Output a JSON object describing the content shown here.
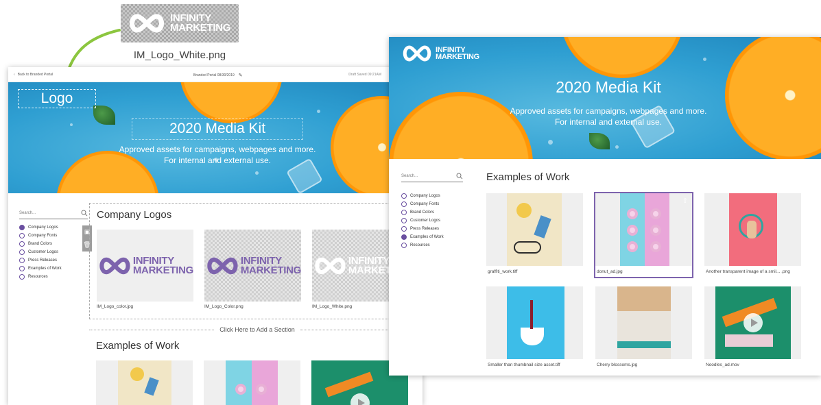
{
  "colors": {
    "brand_purple": "#7d63ad",
    "hero_blue": "#2f9fd2",
    "selection": "#7d63ad"
  },
  "brand": {
    "line1": "INFINITY",
    "line2": "MARKETING"
  },
  "floating_logo": {
    "caption": "IM_Logo_White.png"
  },
  "editor": {
    "back_label": "Back to Branded Portal",
    "portal_title": "Branded Portal 08/30/2019",
    "saved_status": "Draft Saved 09:21AM",
    "hero": {
      "logo_placeholder": "Logo",
      "title": "2020 Media Kit",
      "subtitle": "Approved assets for campaigns, webpages and more. For internal and external use."
    },
    "search_placeholder": "Search...",
    "nav": [
      "Company Logos",
      "Company Fonts",
      "Brand Colors",
      "Customer Logos",
      "Press Releases",
      "Examples of Work",
      "Resources"
    ],
    "active_nav": "Company Logos",
    "section_title": "Company Logos",
    "logo_tiles": [
      "IM_Logo_color.jpg",
      "IM_Logo_Color.png",
      "IM_Logo_White.png"
    ],
    "add_section_label": "Click Here to Add a Section",
    "work_title": "Examples of Work"
  },
  "preview": {
    "hero": {
      "title": "2020 Media Kit",
      "subtitle": "Approved assets for campaigns, webpages and more. For internal and external use."
    },
    "search_placeholder": "Search...",
    "nav": [
      "Company Logos",
      "Company Fonts",
      "Brand Colors",
      "Customer Logos",
      "Press Releases",
      "Examples of Work",
      "Resources"
    ],
    "active_nav": "Examples of Work",
    "section_title": "Examples of Work",
    "assets": [
      "graffiti_work.tiff",
      "donut_ad.jpg",
      "Another transparent image of a smil... .png",
      "Smaller than thumbnail size asset.tiff",
      "Cherry blossoms.jpg",
      "Noodles_ad.mov"
    ],
    "selected_asset": "donut_ad.jpg"
  },
  "icons": {
    "back": "chevron-left-icon",
    "edit": "pencil-icon",
    "search": "search-icon",
    "share": "share-icon",
    "play": "play-icon",
    "image": "image-icon",
    "delete": "trash-icon"
  }
}
